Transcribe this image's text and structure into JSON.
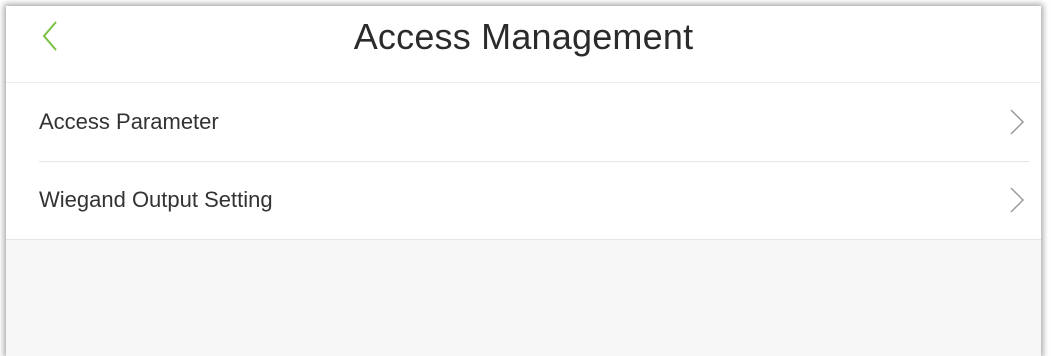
{
  "header": {
    "title": "Access Management",
    "back_icon": "chevron-left-icon",
    "accent_color": "#7ac143"
  },
  "menu": {
    "items": [
      {
        "label": "Access Parameter",
        "icon": "chevron-right-icon"
      },
      {
        "label": "Wiegand Output Setting",
        "icon": "chevron-right-icon"
      }
    ]
  }
}
